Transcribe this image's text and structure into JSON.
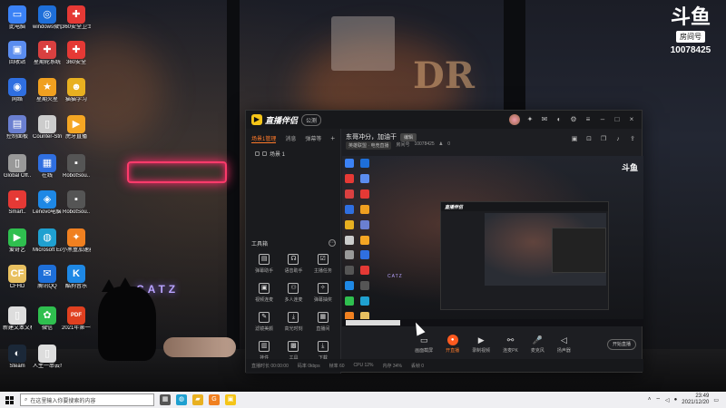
{
  "wallpaper": {
    "neon_sign": "",
    "neon_sign_2": "CATZ",
    "sign_text": "DR"
  },
  "stream_logo": {
    "brand": "斗鱼",
    "room_label": "房间号",
    "room_id": "10078425"
  },
  "desktop_icons": [
    {
      "label": "此电脑",
      "color": "#3b82f6",
      "glyph": "▭"
    },
    {
      "label": "windows微信",
      "color": "#1e6fd9",
      "glyph": "◎"
    },
    {
      "label": "360安全卫士",
      "color": "#e53935",
      "glyph": "✚"
    },
    {
      "label": "回收站",
      "color": "#5b8def",
      "glyph": "▣"
    },
    {
      "label": "星期轮系统",
      "color": "#d94040",
      "glyph": "✚"
    },
    {
      "label": "360安全",
      "color": "#e53935",
      "glyph": "✚"
    },
    {
      "label": "网络",
      "color": "#2f6fe0",
      "glyph": "◉"
    },
    {
      "label": "星期火星",
      "color": "#f0a020",
      "glyph": "★"
    },
    {
      "label": "猫猫学习",
      "color": "#e8b020",
      "glyph": "☻"
    },
    {
      "label": "控制面板",
      "color": "#6a7fd0",
      "glyph": "▤"
    },
    {
      "label": "Counter-Strike",
      "color": "#cccccc",
      "glyph": "▯"
    },
    {
      "label": "虎牙直播",
      "color": "#f5a623",
      "glyph": "▶"
    },
    {
      "label": "Global Off..",
      "color": "#999999",
      "glyph": "▯"
    },
    {
      "label": "在线",
      "color": "#2f6fe0",
      "glyph": "▦"
    },
    {
      "label": "RobotSou..",
      "color": "#555555",
      "glyph": "▪"
    },
    {
      "label": "Smart..",
      "color": "#e53935",
      "glyph": "▪"
    },
    {
      "label": "Lenovo电脑管家",
      "color": "#1e88e5",
      "glyph": "◈"
    },
    {
      "label": "RobotSou..",
      "color": "#555555",
      "glyph": "▪"
    },
    {
      "label": "爱奇艺",
      "color": "#2fbf4f",
      "glyph": "▶"
    },
    {
      "label": "Microsoft Edge",
      "color": "#1fa0d0",
      "glyph": "◍"
    },
    {
      "label": "小黑盒加速器",
      "color": "#f08020",
      "glyph": "✦"
    },
    {
      "label": "CFHD",
      "color": "#e8c060",
      "glyph": "CF"
    },
    {
      "label": "腾讯QQ",
      "color": "#1e6fd9",
      "glyph": "✉"
    },
    {
      "label": "酷狗音乐",
      "color": "#1e88e5",
      "glyph": "K"
    },
    {
      "label": "新建文本文档",
      "color": "#dddddd",
      "glyph": "▯"
    },
    {
      "label": "微信",
      "color": "#2fbf4f",
      "glyph": "✿"
    },
    {
      "label": "2021年第一季度工作总结.pptx",
      "color": "#e04020",
      "glyph": "PDF"
    },
    {
      "label": "Steam",
      "color": "#1b2838",
      "glyph": "◐"
    },
    {
      "label": "人生一串云笔记",
      "color": "#dddddd",
      "glyph": "▯"
    }
  ],
  "app": {
    "name": "直播伴侣",
    "version_badge": "公测",
    "titlebar_icons": [
      "gift-icon",
      "mail-icon",
      "skin-icon",
      "settings-icon",
      "menu-icon",
      "minimize-icon",
      "maximize-icon",
      "close-icon"
    ],
    "scene_tabs": [
      "场景1管理",
      "消息",
      "弹幕等"
    ],
    "scene_item": "场景 1",
    "toolbox_title": "工具箱",
    "tools": [
      {
        "label": "弹幕助手",
        "icon": "▤"
      },
      {
        "label": "语音助手",
        "icon": "☊"
      },
      {
        "label": "主播任务",
        "icon": "☑"
      },
      {
        "label": "视频连麦",
        "icon": "▣"
      },
      {
        "label": "多人连麦",
        "icon": "⚇"
      },
      {
        "label": "弹幕抽奖",
        "icon": "✧"
      },
      {
        "label": "滤镜美颜",
        "icon": "✎"
      },
      {
        "label": "高光时刻",
        "icon": "⤓"
      },
      {
        "label": "直播间",
        "icon": "▦"
      },
      {
        "label": "挂件",
        "icon": "▥"
      },
      {
        "label": "工具",
        "icon": "▩"
      },
      {
        "label": "下载",
        "icon": "⤓"
      }
    ],
    "stream_title": "东哥冲分，加油干",
    "edit_label": "编辑",
    "category_tag": "英雄联盟 · 电竞直播",
    "room_label": "房间号",
    "room_id": "10078425",
    "viewer_count": "0",
    "controls": [
      {
        "label": "画面截屏",
        "icon": "▭",
        "live": false
      },
      {
        "label": "开直播",
        "icon": "●",
        "live": true
      },
      {
        "label": "录制视频",
        "icon": "▶",
        "live": false
      },
      {
        "label": "连麦PK",
        "icon": "⚯",
        "live": false
      },
      {
        "label": "麦克风",
        "icon": "🎤",
        "live": false
      },
      {
        "label": "扬声器",
        "icon": "◁",
        "live": false
      }
    ],
    "start_button": "开始直播",
    "status_items": [
      "直播时长 00:00:00",
      "码率 0kbps",
      "帧率 60",
      "CPU 12%",
      "内存 34%",
      "丢帧 0"
    ]
  },
  "taskbar": {
    "search_placeholder": "在这里输入你要搜索的内容",
    "apps": [
      {
        "name": "task-view",
        "color": "#555555",
        "glyph": "▦"
      },
      {
        "name": "edge",
        "color": "#1fa0d0",
        "glyph": "◍"
      },
      {
        "name": "file-explorer",
        "color": "#e8b020",
        "glyph": "▰"
      },
      {
        "name": "app-g",
        "color": "#f08020",
        "glyph": "G"
      },
      {
        "name": "live-companion",
        "color": "#f5c518",
        "glyph": "▣"
      }
    ],
    "time": "23:49",
    "date": "2021/12/20"
  }
}
